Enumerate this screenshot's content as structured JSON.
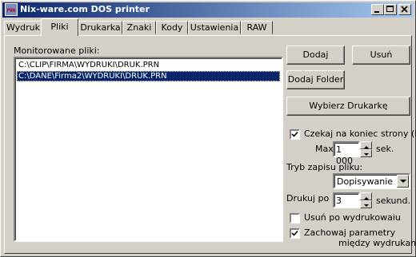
{
  "window": {
    "title": "Nix-ware.com DOS printer",
    "icon_text": "PRN",
    "buttons": [
      "minimize",
      "maximize",
      "close"
    ]
  },
  "tabs": [
    {
      "label": "Wydruk",
      "active": false
    },
    {
      "label": "Pliki",
      "active": true
    },
    {
      "label": "Drukarka",
      "active": false
    },
    {
      "label": "Znaki",
      "active": false
    },
    {
      "label": "Kody",
      "active": false
    },
    {
      "label": "Ustawienia",
      "active": false
    },
    {
      "label": "RAW",
      "active": false
    }
  ],
  "files": {
    "label": "Monitorowane pliki:",
    "items": [
      {
        "path": "C:\\CLIP\\FIRMA\\WYDRUKI\\DRUK.PRN",
        "selected": false
      },
      {
        "path": "C:\\DANE\\Firma2\\WYDRUKI\\DRUK.PRN",
        "selected": true
      }
    ]
  },
  "buttons": {
    "add": "Dodaj",
    "remove": "Usuń",
    "add_folder": "Dodaj Folder",
    "choose_printer": "Wybierz Drukarkę"
  },
  "settings": {
    "wait_ff_label": "Czekaj na koniec strony (FF)",
    "wait_ff_checked": true,
    "max_label": "Max",
    "max_value": "1 000",
    "max_unit": "sek.",
    "write_mode_label": "Tryb zapisu pliku:",
    "write_mode_value": "Dopisywanie",
    "print_every_label": "Drukuj po",
    "print_every_value": "3",
    "print_every_unit": "sekund.",
    "delete_after_label": "Usuń po wydrukowaiu",
    "delete_after_checked": false,
    "keep_params_label_1": "Zachowaj parametry",
    "keep_params_label_2": "między wydrukami",
    "keep_params_checked": true
  },
  "colors": {
    "titlebar_start": "#0a246a",
    "titlebar_end": "#a6caf0",
    "face": "#d4d0c8",
    "selection": "#0a246a"
  }
}
